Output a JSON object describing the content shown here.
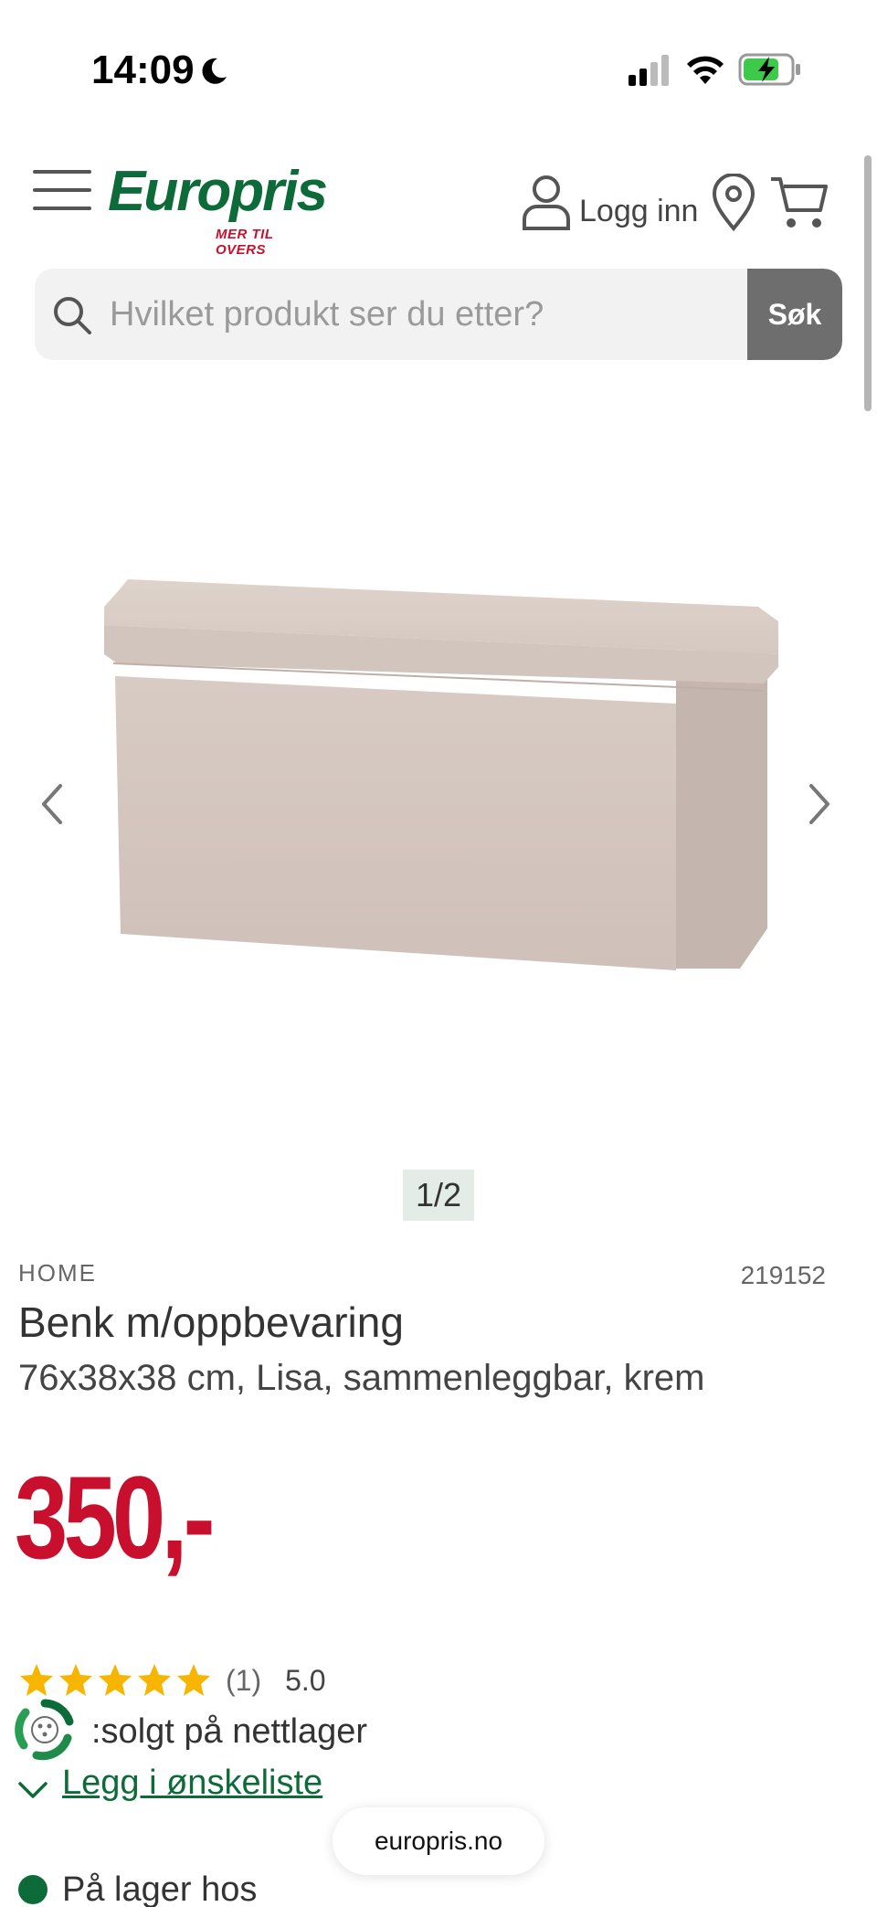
{
  "status_bar": {
    "time": "14:09",
    "icons": [
      "moon-icon",
      "signal-icon",
      "wifi-icon",
      "battery-charging-icon"
    ]
  },
  "header": {
    "brand": "Europris",
    "tagline": "MER TIL OVERS",
    "login_label": "Logg inn",
    "icons": [
      "menu-icon",
      "user-icon",
      "location-pin-icon",
      "cart-icon"
    ]
  },
  "search": {
    "placeholder": "Hvilket produkt ser du etter?",
    "button_label": "Søk"
  },
  "gallery": {
    "page_indicator": "1/2"
  },
  "product": {
    "category": "HOME",
    "sku": "219152",
    "title": "Benk m/oppbevaring",
    "subtitle": "76x38x38 cm, Lisa, sammenleggbar, krem",
    "price": "350,-",
    "rating_count": "(1)",
    "rating_score": "5.0",
    "rating_stars": 5,
    "availability": ":solgt på nettlager",
    "wishlist_label": "Legg i ønskeliste",
    "stock_label": "På lager hos"
  },
  "browser": {
    "url": "europris.no"
  },
  "colors": {
    "brand_green": "#0d6b3a",
    "price_red": "#c8102e",
    "star_yellow": "#f7b500",
    "search_button": "#6e6e6e"
  }
}
